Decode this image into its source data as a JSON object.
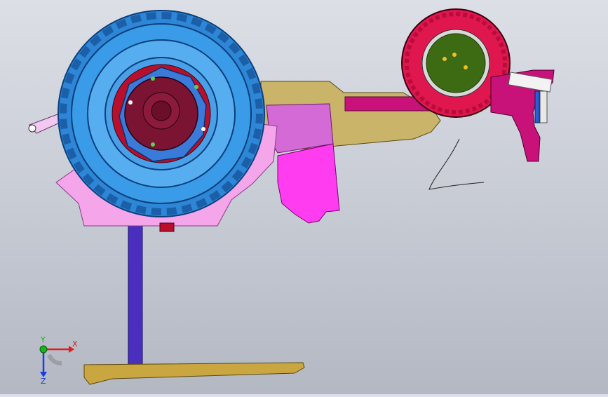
{
  "viewport": {
    "background_top": "#dcdfe6",
    "background_bottom": "#b3b8c3"
  },
  "model": {
    "parts": [
      {
        "name": "main-drive-wheel",
        "tire_color": "#3a9be8",
        "hub_color": "#7a1432"
      },
      {
        "name": "gauge-wheel",
        "tire_color": "#e0174f",
        "hub_color": "#3d6b14"
      },
      {
        "name": "main-frame",
        "color": "#c9b46a"
      },
      {
        "name": "gearbox-housing",
        "color": "#ff3cf0"
      },
      {
        "name": "fender",
        "color": "#f5a6ea"
      },
      {
        "name": "stand-post",
        "color": "#4a2fbf"
      },
      {
        "name": "base-skid",
        "color": "#c9a640"
      },
      {
        "name": "rear-bracket",
        "color": "#c8127a"
      },
      {
        "name": "front-handle",
        "color": "#f0c8f0"
      }
    ]
  },
  "triad": {
    "x_label": "X",
    "y_label": "Y",
    "z_label": "Z",
    "x_color": "#e01c1c",
    "y_color": "#18b418",
    "z_color": "#1c3ce0"
  }
}
